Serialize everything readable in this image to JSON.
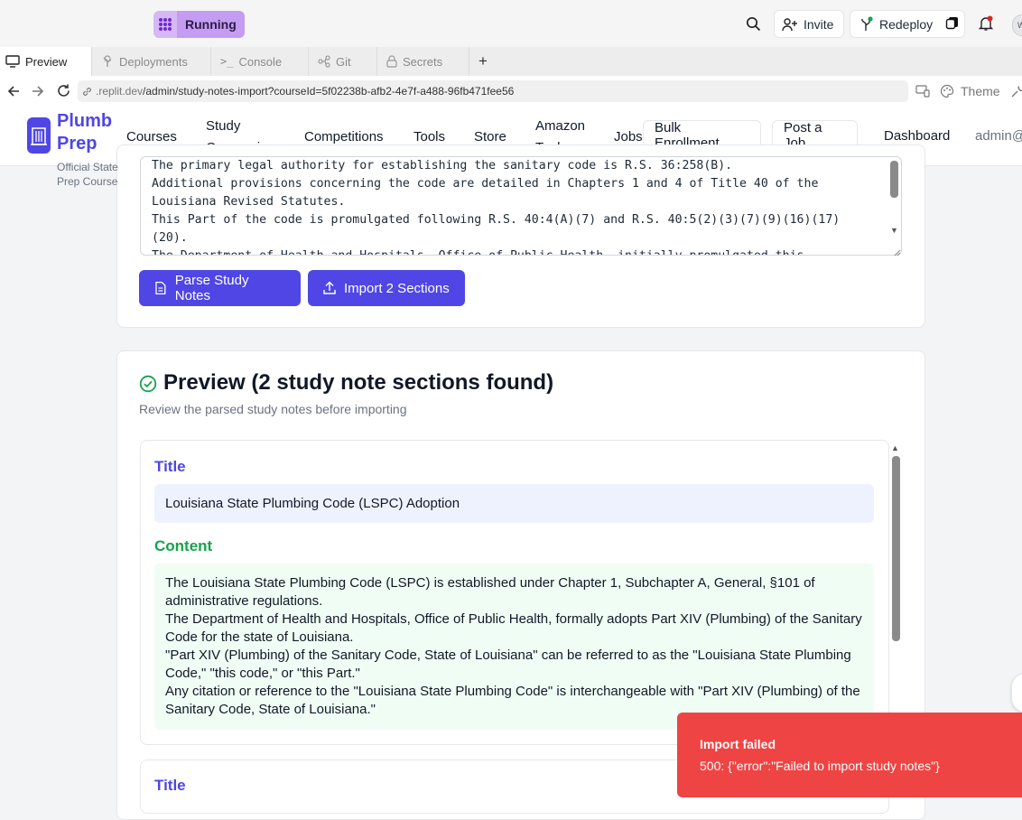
{
  "replit": {
    "run_status": "Running",
    "invite_label": "Invite",
    "redeploy_label": "Redeploy",
    "avatar_initial": "W",
    "tabs": [
      {
        "label": "Preview"
      },
      {
        "label": "Deployments"
      },
      {
        "label": "Console"
      },
      {
        "label": "Git"
      },
      {
        "label": "Secrets"
      }
    ],
    "add_tab": "+",
    "url_host": ".replit.dev",
    "url_path": "/admin/study-notes-import?courseId=5f02238b-afb2-4e7f-a488-96fb471fee56",
    "theme_label": "Theme"
  },
  "site": {
    "logo_line1": "Plumb",
    "logo_line2": "Prep",
    "tagline_line1": "Official State",
    "tagline_line2": "Prep Course",
    "nav": {
      "courses": "Courses",
      "study_line1": "Study",
      "study_line2": "Companion",
      "competitions": "Competitions",
      "tools": "Tools",
      "store": "Store",
      "amazon_line1": "Amazon",
      "amazon_line2": "Tools",
      "jobs": "Jobs",
      "bulk": "Bulk Enrollment",
      "post_job": "Post a Job",
      "dashboard": "Dashboard",
      "admin": "admin@"
    }
  },
  "import_card": {
    "notes_text": "The primary legal authority for establishing the sanitary code is R.S. 36:258(B).\nAdditional provisions concerning the code are detailed in Chapters 1 and 4 of Title 40 of the Louisiana Revised Statutes.\nThis Part of the code is promulgated following R.S. 40:4(A)(7) and R.S. 40:5(2)(3)(7)(9)(16)(17)(20).\nThe Department of Health and Hospitals, Office of Public Health, initially promulgated this",
    "parse_button": "Parse Study Notes",
    "import_button": "Import 2 Sections"
  },
  "preview": {
    "title": "Preview (2 study note sections found)",
    "subtitle": "Review the parsed study notes before importing",
    "title_label": "Title",
    "content_label": "Content",
    "section_title": "Louisiana State Plumbing Code (LSPC) Adoption",
    "content_lines": [
      "The Louisiana State Plumbing Code (LSPC) is established under Chapter 1, Subchapter A, General, §101 of administrative regulations.",
      "The Department of Health and Hospitals, Office of Public Health, formally adopts Part XIV (Plumbing) of the Sanitary Code for the state of Louisiana.",
      "\"Part XIV (Plumbing) of the Sanitary Code, State of Louisiana\" can be referred to as the \"Louisiana State Plumbing Code,\" \"this code,\" or \"this Part.\"",
      "Any citation or reference to the \"Louisiana State Plumbing Code\" is interchangeable with \"Part XIV (Plumbing) of the Sanitary Code, State of Louisiana.\""
    ],
    "next_title_label": "Title"
  },
  "toast": {
    "title": "Import failed",
    "message": "500: {\"error\":\"Failed to import study notes\"}"
  },
  "colors": {
    "accent": "#4f46e5",
    "success": "#16a34a",
    "error": "#ef4444",
    "run_badge": "#c49cf2"
  }
}
